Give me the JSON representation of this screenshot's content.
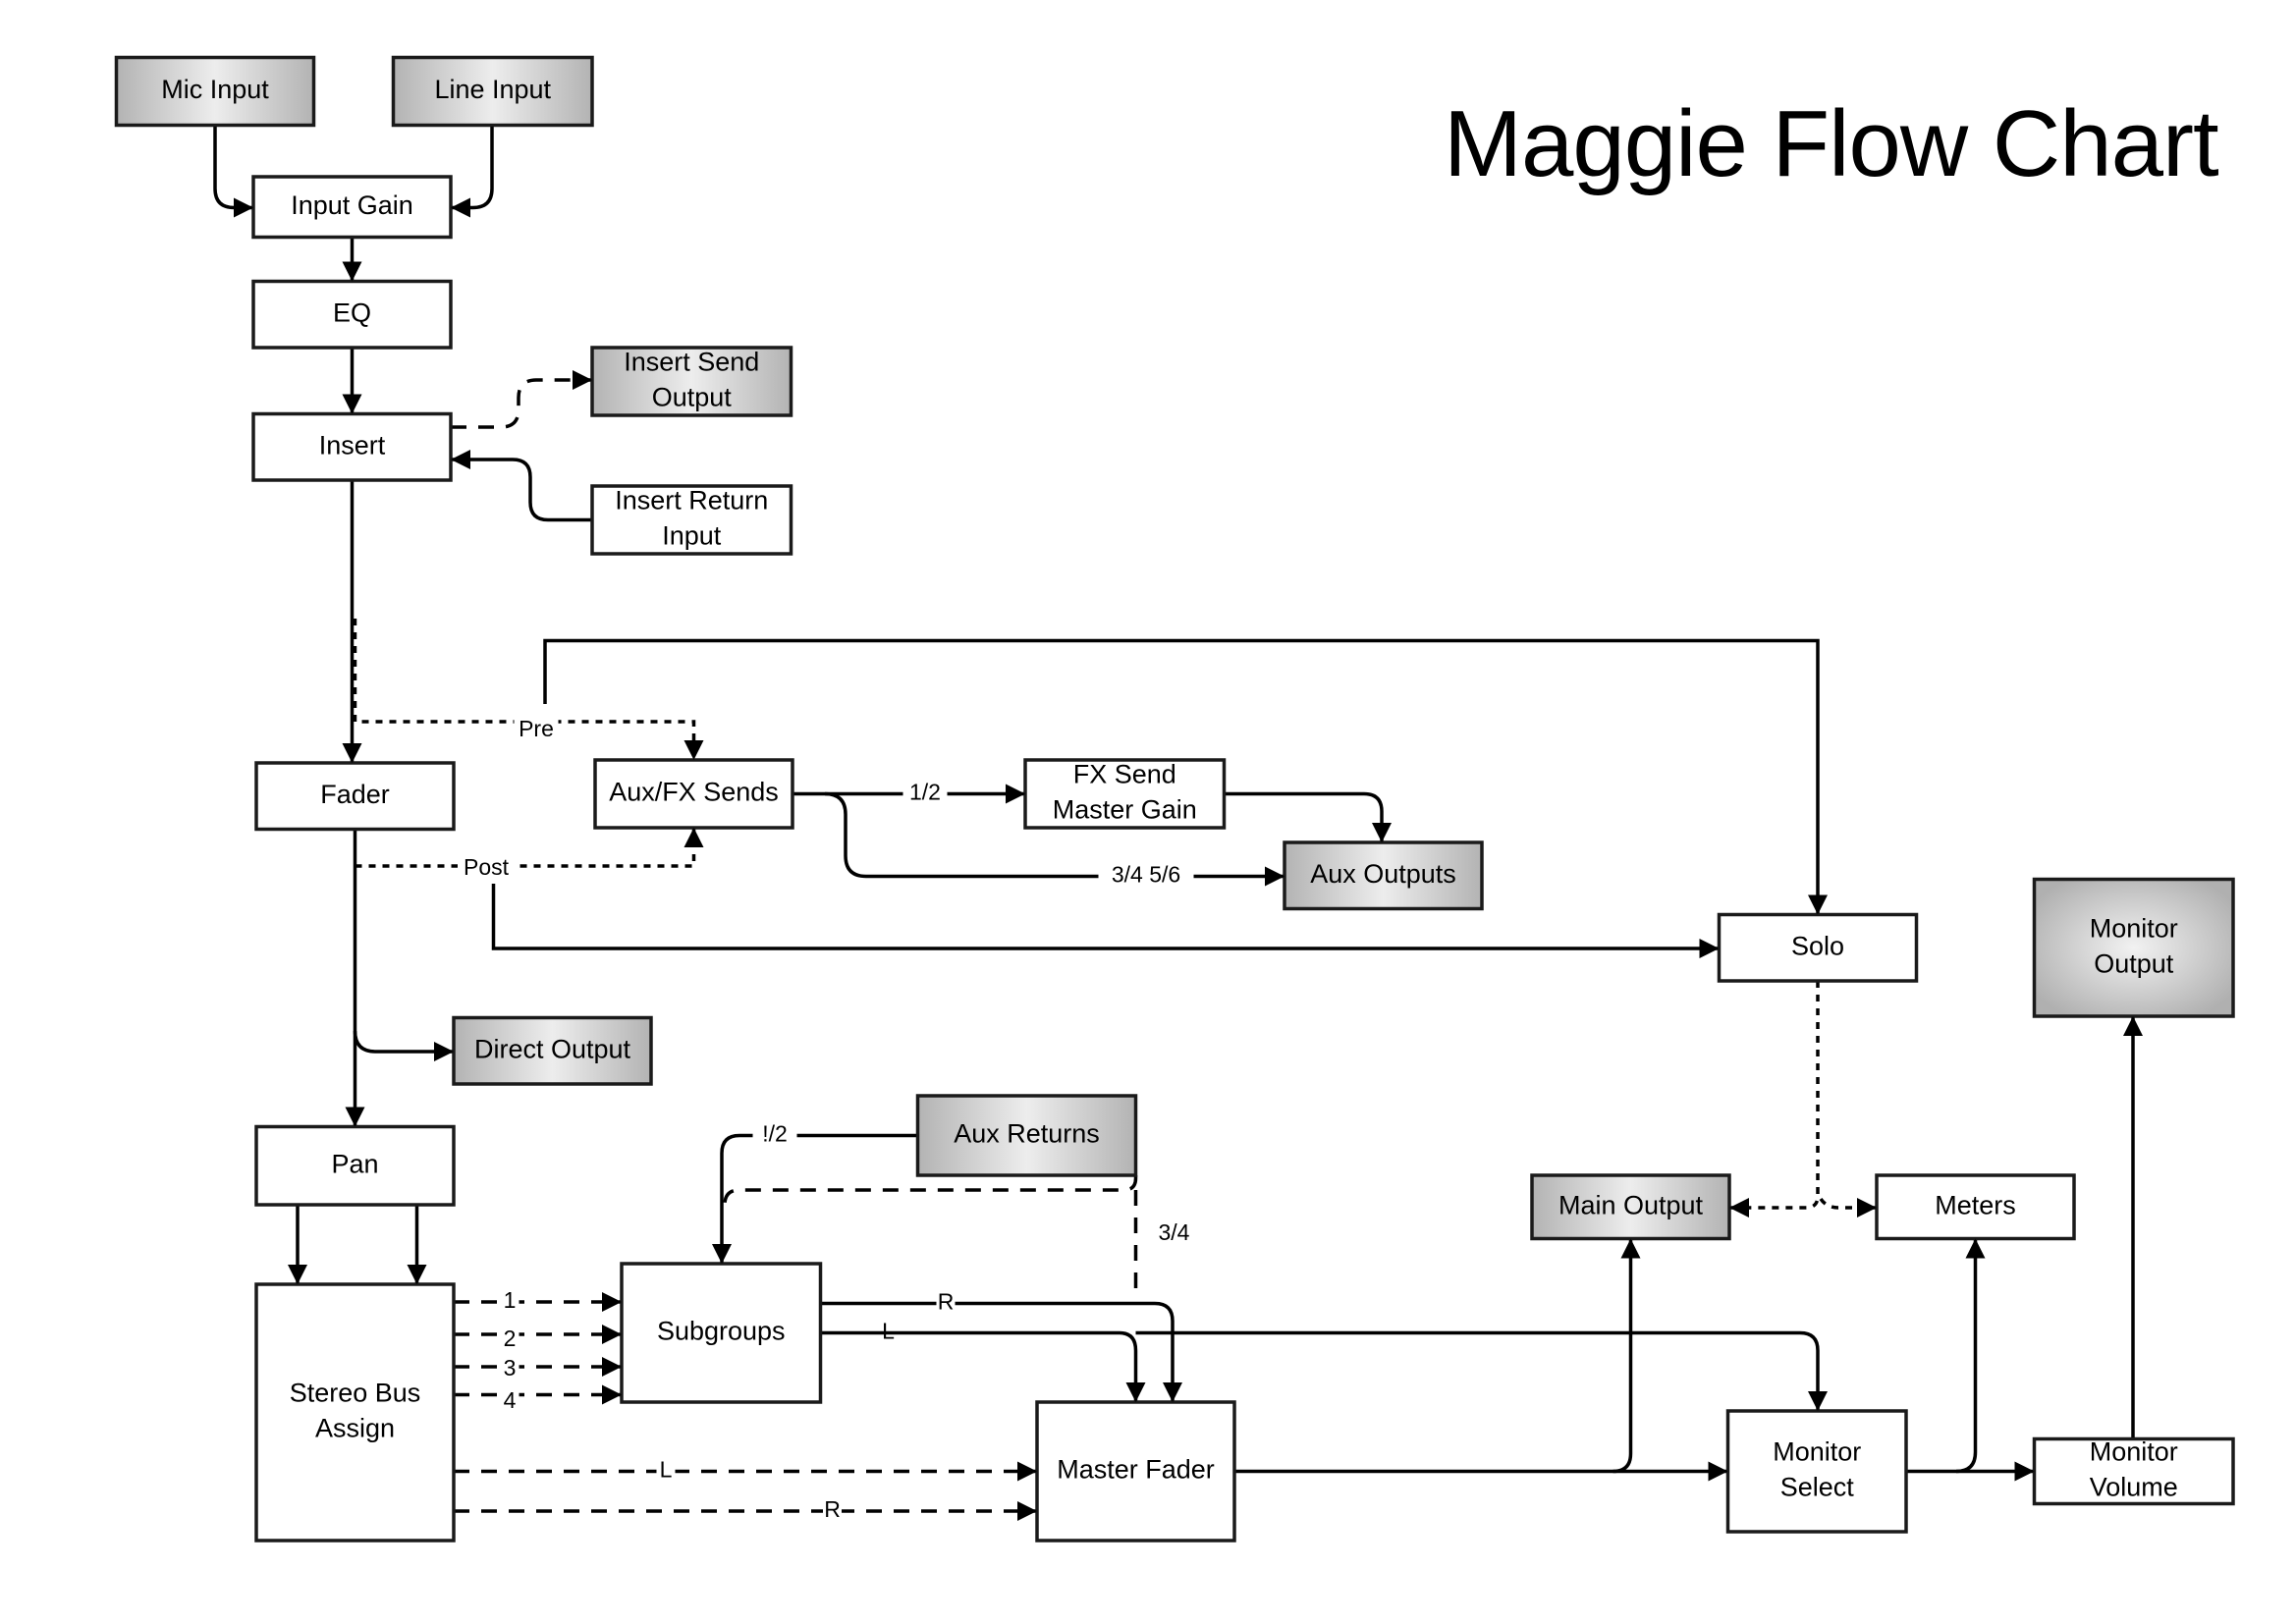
{
  "title": "Maggie Flow Chart",
  "nodes": {
    "mic_input": {
      "label": [
        "Mic Input"
      ],
      "style": "shaded"
    },
    "line_input": {
      "label": [
        "Line Input"
      ],
      "style": "shaded"
    },
    "input_gain": {
      "label": [
        "Input Gain"
      ],
      "style": "plain"
    },
    "eq": {
      "label": [
        "EQ"
      ],
      "style": "plain"
    },
    "insert": {
      "label": [
        "Insert"
      ],
      "style": "plain"
    },
    "insert_send_output": {
      "label": [
        "Insert Send",
        "Output"
      ],
      "style": "shaded"
    },
    "insert_return_input": {
      "label": [
        "Insert Return",
        "Input"
      ],
      "style": "plain"
    },
    "fader": {
      "label": [
        "Fader"
      ],
      "style": "plain"
    },
    "aux_fx_sends": {
      "label": [
        "Aux/FX Sends"
      ],
      "style": "plain"
    },
    "fx_send_master_gain": {
      "label": [
        "FX Send",
        "Master Gain"
      ],
      "style": "plain"
    },
    "aux_outputs": {
      "label": [
        "Aux Outputs"
      ],
      "style": "shaded"
    },
    "solo": {
      "label": [
        "Solo"
      ],
      "style": "plain"
    },
    "monitor_output": {
      "label": [
        "Monitor",
        "Output"
      ],
      "style": "shaded"
    },
    "direct_output": {
      "label": [
        "Direct Output"
      ],
      "style": "shaded"
    },
    "pan": {
      "label": [
        "Pan"
      ],
      "style": "plain"
    },
    "aux_returns": {
      "label": [
        "Aux Returns"
      ],
      "style": "shaded"
    },
    "main_output": {
      "label": [
        "Main Output"
      ],
      "style": "shaded"
    },
    "meters": {
      "label": [
        "Meters"
      ],
      "style": "plain"
    },
    "stereo_bus_assign": {
      "label": [
        "Stereo Bus",
        "Assign"
      ],
      "style": "plain"
    },
    "subgroups": {
      "label": [
        "Subgroups"
      ],
      "style": "plain"
    },
    "master_fader": {
      "label": [
        "Master Fader"
      ],
      "style": "plain"
    },
    "monitor_select": {
      "label": [
        "Monitor",
        "Select"
      ],
      "style": "plain"
    },
    "monitor_volume": {
      "label": [
        "Monitor",
        "Volume"
      ],
      "style": "plain"
    }
  },
  "edge_labels": {
    "pre": "Pre",
    "post": "Post",
    "fx_1_2": "1/2",
    "aux_3456": "3/4 5/6",
    "aux_return_12": "!/2",
    "aux_return_34": "3/4",
    "bus_1": "1",
    "bus_2": "2",
    "bus_3": "3",
    "bus_4": "4",
    "stereo_l": "L",
    "stereo_r": "R",
    "sub_r": "R",
    "sub_l": "L"
  },
  "edges": [
    {
      "from": "mic_input",
      "to": "input_gain",
      "style": "solid"
    },
    {
      "from": "line_input",
      "to": "input_gain",
      "style": "solid"
    },
    {
      "from": "input_gain",
      "to": "eq",
      "style": "solid"
    },
    {
      "from": "eq",
      "to": "insert",
      "style": "solid"
    },
    {
      "from": "insert",
      "to": "insert_send_output",
      "style": "dashed"
    },
    {
      "from": "insert_return_input",
      "to": "insert",
      "style": "solid"
    },
    {
      "from": "insert",
      "to": "fader",
      "style": "solid"
    },
    {
      "from": "insert",
      "to": "aux_fx_sends",
      "style": "dotted",
      "label": "Pre"
    },
    {
      "from": "fader",
      "to": "aux_fx_sends",
      "style": "dotted",
      "label": "Post"
    },
    {
      "from": "insert",
      "to": "solo",
      "style": "solid"
    },
    {
      "from": "fader",
      "to": "solo",
      "style": "solid"
    },
    {
      "from": "aux_fx_sends",
      "to": "fx_send_master_gain",
      "style": "solid",
      "label": "1/2"
    },
    {
      "from": "aux_fx_sends",
      "to": "aux_outputs",
      "style": "solid",
      "label": "3/4 5/6"
    },
    {
      "from": "fx_send_master_gain",
      "to": "aux_outputs",
      "style": "solid"
    },
    {
      "from": "fader",
      "to": "direct_output",
      "style": "solid"
    },
    {
      "from": "fader",
      "to": "pan",
      "style": "solid"
    },
    {
      "from": "pan",
      "to": "stereo_bus_assign",
      "style": "solid"
    },
    {
      "from": "stereo_bus_assign",
      "to": "subgroups",
      "style": "dashed",
      "label": "1, 2, 3, 4"
    },
    {
      "from": "stereo_bus_assign",
      "to": "master_fader",
      "style": "dashed",
      "label": "L, R"
    },
    {
      "from": "aux_returns",
      "to": "subgroups",
      "style": "solid",
      "label": "!/2"
    },
    {
      "from": "aux_returns",
      "to": "master_fader",
      "style": "dashed",
      "label": "3/4"
    },
    {
      "from": "subgroups",
      "to": "master_fader",
      "style": "solid",
      "label": "R"
    },
    {
      "from": "subgroups",
      "to": "monitor_select",
      "style": "solid",
      "label": "L"
    },
    {
      "from": "solo",
      "to": "main_output",
      "style": "dotted"
    },
    {
      "from": "solo",
      "to": "meters",
      "style": "dotted"
    },
    {
      "from": "master_fader",
      "to": "main_output",
      "style": "solid"
    },
    {
      "from": "master_fader",
      "to": "monitor_select",
      "style": "solid"
    },
    {
      "from": "monitor_select",
      "to": "meters",
      "style": "solid"
    },
    {
      "from": "monitor_select",
      "to": "monitor_volume",
      "style": "solid"
    },
    {
      "from": "monitor_volume",
      "to": "monitor_output",
      "style": "solid"
    }
  ]
}
